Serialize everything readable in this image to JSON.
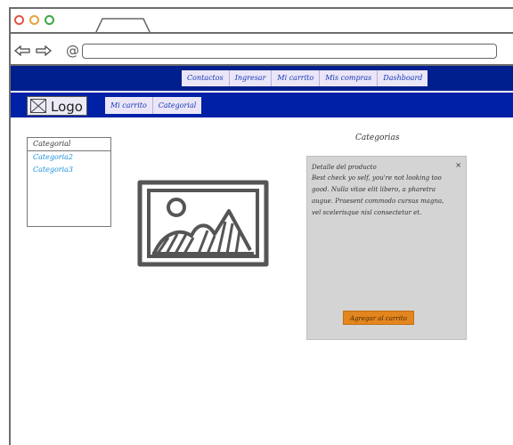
{
  "nav": {
    "items": [
      "Contactos",
      "Ingresar",
      "Mi carrito",
      "Mis compras",
      "Dashboard"
    ]
  },
  "brand": {
    "logo": "Logo",
    "items": [
      "Mi carrito",
      "Categorial"
    ]
  },
  "categories": {
    "items": [
      "Categorial",
      "Categoria2",
      "Categoria3"
    ]
  },
  "panel": {
    "title": "Categorias",
    "heading": "Detalle del producto",
    "body": "Best check yo self, you're not looking too good. Nulla vitae elit libero, a pharetra augue. Praesent commodo cursus magna, vel scelerisque nisl consectetur et.",
    "close": "×",
    "button": "Agregar al carrito"
  },
  "icons": {
    "back": "arrow-left-icon",
    "forward": "arrow-right-icon",
    "at": "at-icon",
    "logo": "logo-placeholder-icon",
    "image": "image-placeholder-icon"
  },
  "colors": {
    "navbar": "#001f8e",
    "brandbar": "#0021a6",
    "button": "#e3861f",
    "panel": "#d4d4d4"
  }
}
